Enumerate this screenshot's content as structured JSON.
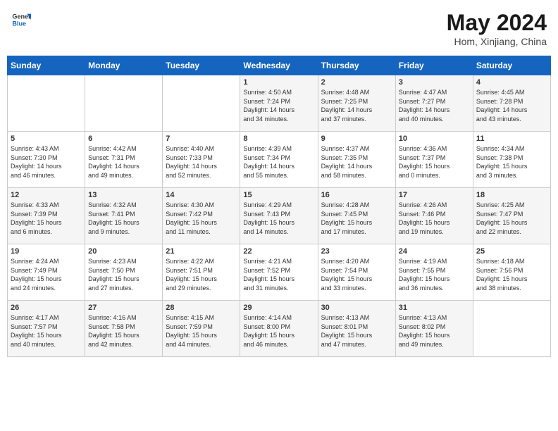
{
  "header": {
    "logo_general": "General",
    "logo_blue": "Blue",
    "month_title": "May 2024",
    "location": "Hom, Xinjiang, China"
  },
  "days_of_week": [
    "Sunday",
    "Monday",
    "Tuesday",
    "Wednesday",
    "Thursday",
    "Friday",
    "Saturday"
  ],
  "weeks": [
    [
      {
        "day": "",
        "info": ""
      },
      {
        "day": "",
        "info": ""
      },
      {
        "day": "",
        "info": ""
      },
      {
        "day": "1",
        "info": "Sunrise: 4:50 AM\nSunset: 7:24 PM\nDaylight: 14 hours\nand 34 minutes."
      },
      {
        "day": "2",
        "info": "Sunrise: 4:48 AM\nSunset: 7:25 PM\nDaylight: 14 hours\nand 37 minutes."
      },
      {
        "day": "3",
        "info": "Sunrise: 4:47 AM\nSunset: 7:27 PM\nDaylight: 14 hours\nand 40 minutes."
      },
      {
        "day": "4",
        "info": "Sunrise: 4:45 AM\nSunset: 7:28 PM\nDaylight: 14 hours\nand 43 minutes."
      }
    ],
    [
      {
        "day": "5",
        "info": "Sunrise: 4:43 AM\nSunset: 7:30 PM\nDaylight: 14 hours\nand 46 minutes."
      },
      {
        "day": "6",
        "info": "Sunrise: 4:42 AM\nSunset: 7:31 PM\nDaylight: 14 hours\nand 49 minutes."
      },
      {
        "day": "7",
        "info": "Sunrise: 4:40 AM\nSunset: 7:33 PM\nDaylight: 14 hours\nand 52 minutes."
      },
      {
        "day": "8",
        "info": "Sunrise: 4:39 AM\nSunset: 7:34 PM\nDaylight: 14 hours\nand 55 minutes."
      },
      {
        "day": "9",
        "info": "Sunrise: 4:37 AM\nSunset: 7:35 PM\nDaylight: 14 hours\nand 58 minutes."
      },
      {
        "day": "10",
        "info": "Sunrise: 4:36 AM\nSunset: 7:37 PM\nDaylight: 15 hours\nand 0 minutes."
      },
      {
        "day": "11",
        "info": "Sunrise: 4:34 AM\nSunset: 7:38 PM\nDaylight: 15 hours\nand 3 minutes."
      }
    ],
    [
      {
        "day": "12",
        "info": "Sunrise: 4:33 AM\nSunset: 7:39 PM\nDaylight: 15 hours\nand 6 minutes."
      },
      {
        "day": "13",
        "info": "Sunrise: 4:32 AM\nSunset: 7:41 PM\nDaylight: 15 hours\nand 9 minutes."
      },
      {
        "day": "14",
        "info": "Sunrise: 4:30 AM\nSunset: 7:42 PM\nDaylight: 15 hours\nand 11 minutes."
      },
      {
        "day": "15",
        "info": "Sunrise: 4:29 AM\nSunset: 7:43 PM\nDaylight: 15 hours\nand 14 minutes."
      },
      {
        "day": "16",
        "info": "Sunrise: 4:28 AM\nSunset: 7:45 PM\nDaylight: 15 hours\nand 17 minutes."
      },
      {
        "day": "17",
        "info": "Sunrise: 4:26 AM\nSunset: 7:46 PM\nDaylight: 15 hours\nand 19 minutes."
      },
      {
        "day": "18",
        "info": "Sunrise: 4:25 AM\nSunset: 7:47 PM\nDaylight: 15 hours\nand 22 minutes."
      }
    ],
    [
      {
        "day": "19",
        "info": "Sunrise: 4:24 AM\nSunset: 7:49 PM\nDaylight: 15 hours\nand 24 minutes."
      },
      {
        "day": "20",
        "info": "Sunrise: 4:23 AM\nSunset: 7:50 PM\nDaylight: 15 hours\nand 27 minutes."
      },
      {
        "day": "21",
        "info": "Sunrise: 4:22 AM\nSunset: 7:51 PM\nDaylight: 15 hours\nand 29 minutes."
      },
      {
        "day": "22",
        "info": "Sunrise: 4:21 AM\nSunset: 7:52 PM\nDaylight: 15 hours\nand 31 minutes."
      },
      {
        "day": "23",
        "info": "Sunrise: 4:20 AM\nSunset: 7:54 PM\nDaylight: 15 hours\nand 33 minutes."
      },
      {
        "day": "24",
        "info": "Sunrise: 4:19 AM\nSunset: 7:55 PM\nDaylight: 15 hours\nand 36 minutes."
      },
      {
        "day": "25",
        "info": "Sunrise: 4:18 AM\nSunset: 7:56 PM\nDaylight: 15 hours\nand 38 minutes."
      }
    ],
    [
      {
        "day": "26",
        "info": "Sunrise: 4:17 AM\nSunset: 7:57 PM\nDaylight: 15 hours\nand 40 minutes."
      },
      {
        "day": "27",
        "info": "Sunrise: 4:16 AM\nSunset: 7:58 PM\nDaylight: 15 hours\nand 42 minutes."
      },
      {
        "day": "28",
        "info": "Sunrise: 4:15 AM\nSunset: 7:59 PM\nDaylight: 15 hours\nand 44 minutes."
      },
      {
        "day": "29",
        "info": "Sunrise: 4:14 AM\nSunset: 8:00 PM\nDaylight: 15 hours\nand 46 minutes."
      },
      {
        "day": "30",
        "info": "Sunrise: 4:13 AM\nSunset: 8:01 PM\nDaylight: 15 hours\nand 47 minutes."
      },
      {
        "day": "31",
        "info": "Sunrise: 4:13 AM\nSunset: 8:02 PM\nDaylight: 15 hours\nand 49 minutes."
      },
      {
        "day": "",
        "info": ""
      }
    ]
  ]
}
